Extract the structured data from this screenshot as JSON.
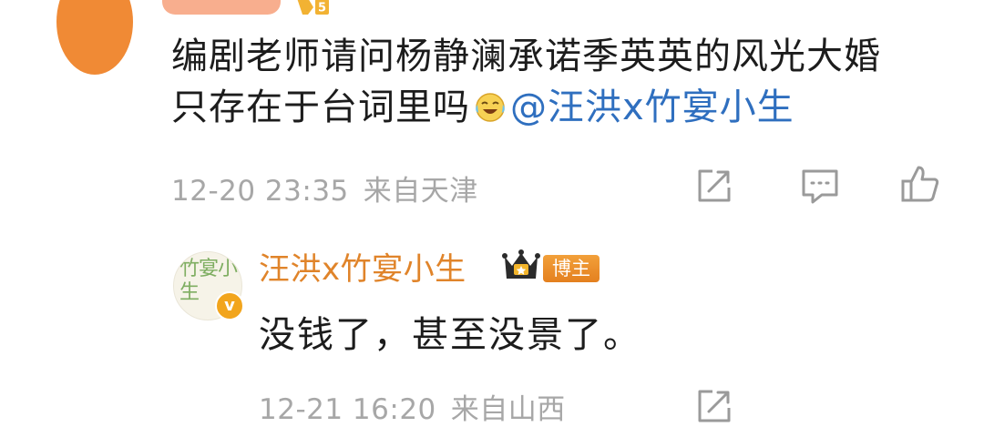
{
  "comment": {
    "level": "5",
    "text_line1": "编剧老师请问杨静澜承诺季英英的风光大婚",
    "text_line2_before": "只存在于台词里吗",
    "mention": "@汪洪x竹宴小生",
    "date": "12-20 23:35",
    "location": "来自天津"
  },
  "reply": {
    "avatar_text": "竹宴小生",
    "verified_mark": "v",
    "author": "汪洪x竹宴小生",
    "badge": "博主",
    "text": "没钱了，甚至没景了。",
    "date": "12-21 16:20",
    "location": "来自山西"
  },
  "colors": {
    "mention": "#2f6fbf",
    "author_name": "#e0842a",
    "badge_bg": "#e98a26",
    "meta_gray": "#a7a7a7"
  },
  "icons": {
    "share": "share-icon",
    "comment": "comment-icon",
    "like": "thumbs-up-icon",
    "emoji": "laughing-crying-emoji-icon",
    "crown": "crown-icon"
  }
}
